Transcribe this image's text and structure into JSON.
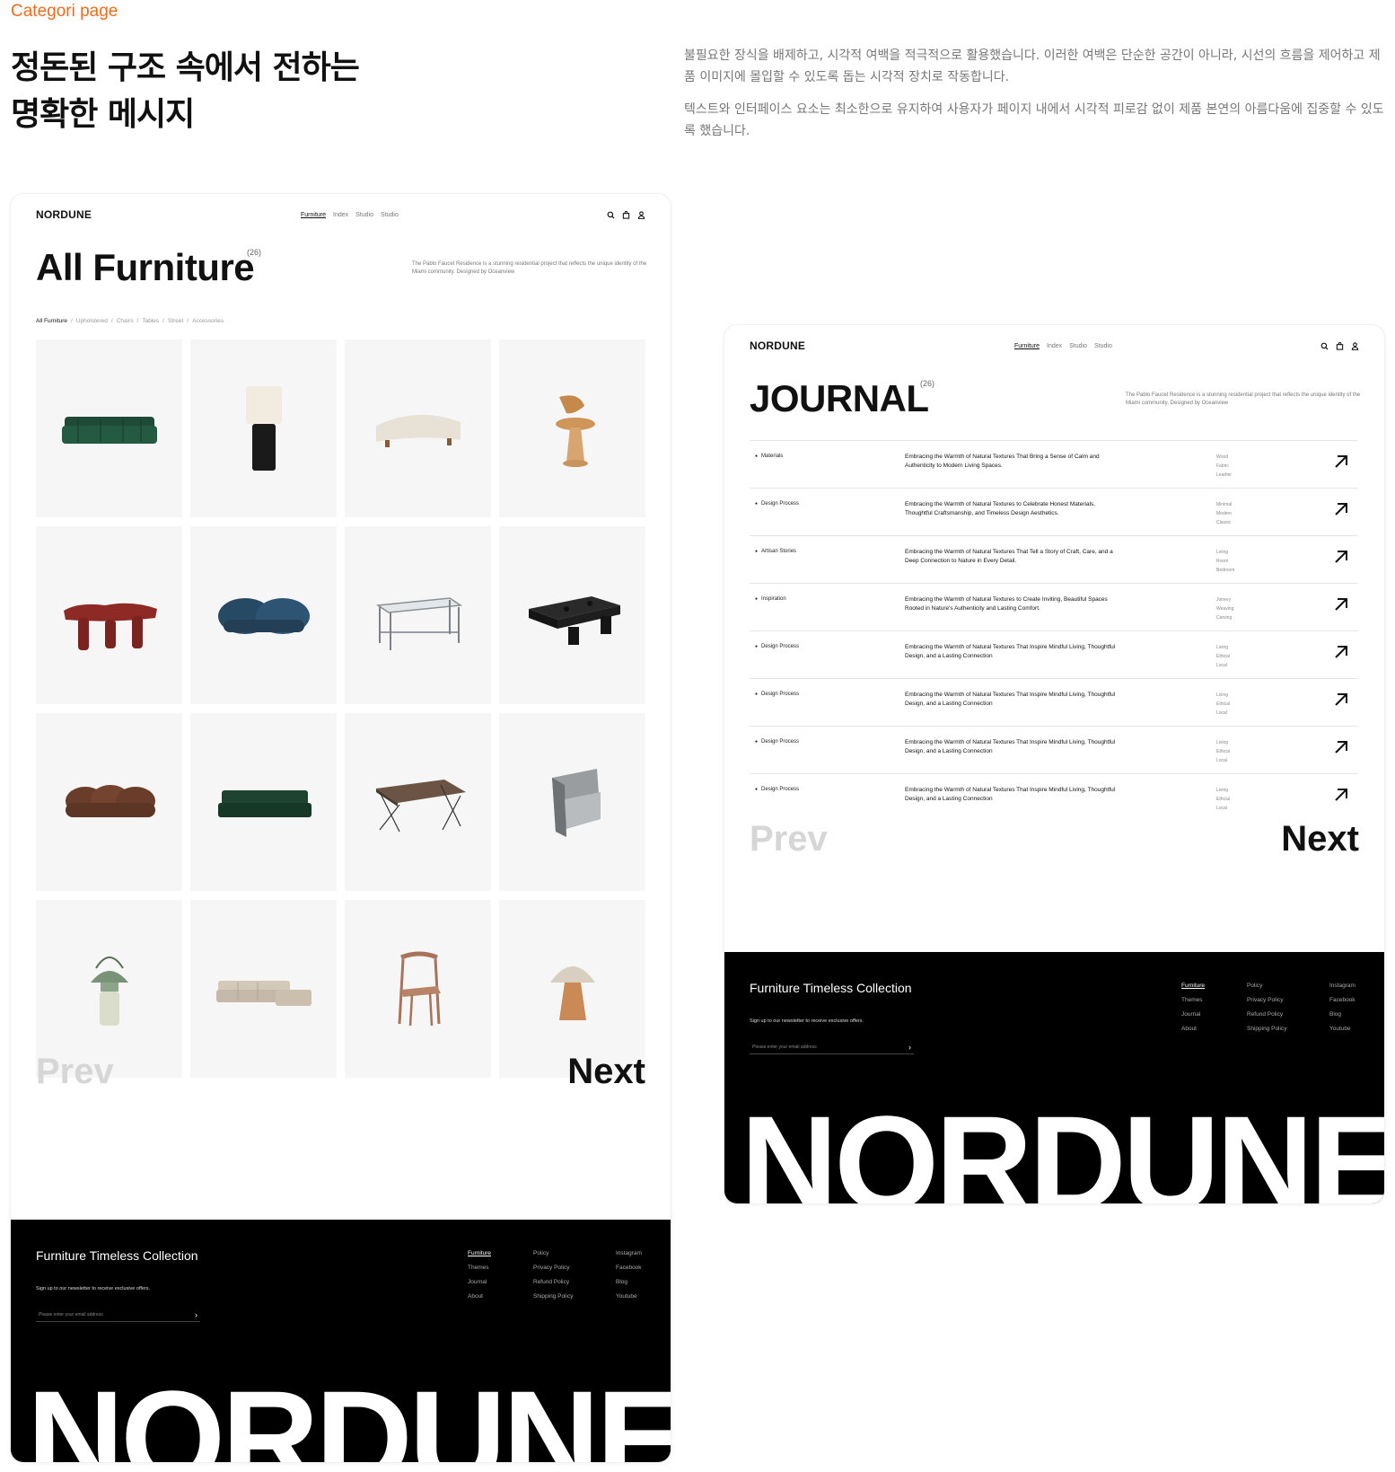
{
  "page": {
    "label": "Categori page",
    "headline": [
      "정돈된 구조 속에서 전하는",
      "명확한 메시지"
    ],
    "paragraphs": [
      "불필요한 장식을 배제하고, 시각적 여백을 적극적으로 활용했습니다. 이러한 여백은 단순한 공간이 아니라, 시선의 흐름을 제어하고 제품 이미지에 몰입할 수 있도록 돕는 시각적 장치로 작동합니다.",
      "텍스트와 인터페이스 요소는 최소한으로 유지하여 사용자가 페이지 내에서 시각적 피로감 없이 제품 본연의 아름다움에 집중할 수 있도록 했습니다."
    ]
  },
  "nav": {
    "brand": "NORDUNE",
    "links": [
      "Furniture",
      "Index",
      "Studio",
      "Studio"
    ],
    "icons": [
      "search-icon",
      "bag-icon",
      "user-icon"
    ]
  },
  "furniture": {
    "title": "All Furniture",
    "count": "(26)",
    "blurb": "The Pablo Faucet Residence is a stunning residential project that reflects the unique identity of the Miami community. Designed by Oceanview",
    "crumbs": [
      "All Furniture",
      "/",
      "Upholstered",
      "/",
      "Chairs",
      "/",
      "Tables",
      "/",
      "Street",
      "/",
      "Accessories"
    ],
    "products": [
      "green-sofa",
      "table-lamp",
      "curved-cream-sofa",
      "wooden-chair",
      "red-table",
      "blue-loveseat",
      "glass-table",
      "black-bench",
      "brown-sofa",
      "green-bench-sofa",
      "wood-desk",
      "metal-chair",
      "green-lantern",
      "sectional-sofa",
      "wood-armchair",
      "mushroom-lamp"
    ]
  },
  "journal": {
    "title": "JOURNAL",
    "count": "(26)",
    "blurb": "The Pablo Faucet Residence is a stunning residential project that reflects the unique identity of the Miami community. Designed by Oceanview",
    "rows": [
      {
        "cat": "Materials",
        "title": "Embracing the Warmth of Natural Textures That Bring a Sense of Calm and Authenticity to Modern Living Spaces.",
        "tags": [
          "Wood",
          "Fabric",
          "Leather"
        ]
      },
      {
        "cat": "Design Process",
        "title": "Embracing the Warmth of Natural Textures to Celebrate Honest Materials, Thoughtful Craftsmanship, and Timeless Design Aesthetics.",
        "tags": [
          "Minimal",
          "Modern",
          "Classic"
        ]
      },
      {
        "cat": "Artisan Stories",
        "title": "Embracing the Warmth of Natural Textures That Tell a Story of Craft, Care, and a Deep Connection to Nature in Every Detail.",
        "tags": [
          "Living",
          "Room",
          "Bedroom"
        ]
      },
      {
        "cat": "Inspiration",
        "title": "Embracing the Warmth of Natural Textures to Create Inviting, Beautiful Spaces Rooted in Nature's Authenticity and Lasting Comfort.",
        "tags": [
          "Joinery",
          "Weaving",
          "Carving"
        ]
      },
      {
        "cat": "Design Process",
        "title": "Embracing the Warmth of Natural Textures That Inspire Mindful Living, Thoughtful Design, and a Lasting Connection",
        "tags": [
          "Living",
          "Ethical",
          "Local"
        ]
      },
      {
        "cat": "Design Process",
        "title": "Embracing the Warmth of Natural Textures That Inspire Mindful Living, Thoughtful Design, and a Lasting Connection",
        "tags": [
          "Living",
          "Ethical",
          "Local"
        ]
      },
      {
        "cat": "Design Process",
        "title": "Embracing the Warmth of Natural Textures That Inspire Mindful Living, Thoughtful Design, and a Lasting Connection",
        "tags": [
          "Living",
          "Ethical",
          "Local"
        ]
      },
      {
        "cat": "Design Process",
        "title": "Embracing the Warmth of Natural Textures That Inspire Mindful Living, Thoughtful Design, and a Lasting Connection",
        "tags": [
          "Living",
          "Ethical",
          "Local"
        ]
      }
    ]
  },
  "pager": {
    "prev": "Prev",
    "next": "Next"
  },
  "footer": {
    "title": "Furniture Timeless Collection",
    "signup": "Sign up to our newsletter to receive exclusive offers.",
    "placeholder": "Please enter your email address",
    "col1": [
      "Furniture",
      "Themes",
      "Journal",
      "About"
    ],
    "col2": [
      "Policy",
      "Privacy Policy",
      "Refund Policy",
      "Shipping Policy"
    ],
    "col3": [
      "Instagram",
      "Facebook",
      "Blog",
      "Youtube"
    ],
    "wordmark": "NORDUNE"
  },
  "colors": {
    "accent": "#f06a1b",
    "footer_bg": "#000000",
    "tile_bg": "#f6f6f6"
  }
}
